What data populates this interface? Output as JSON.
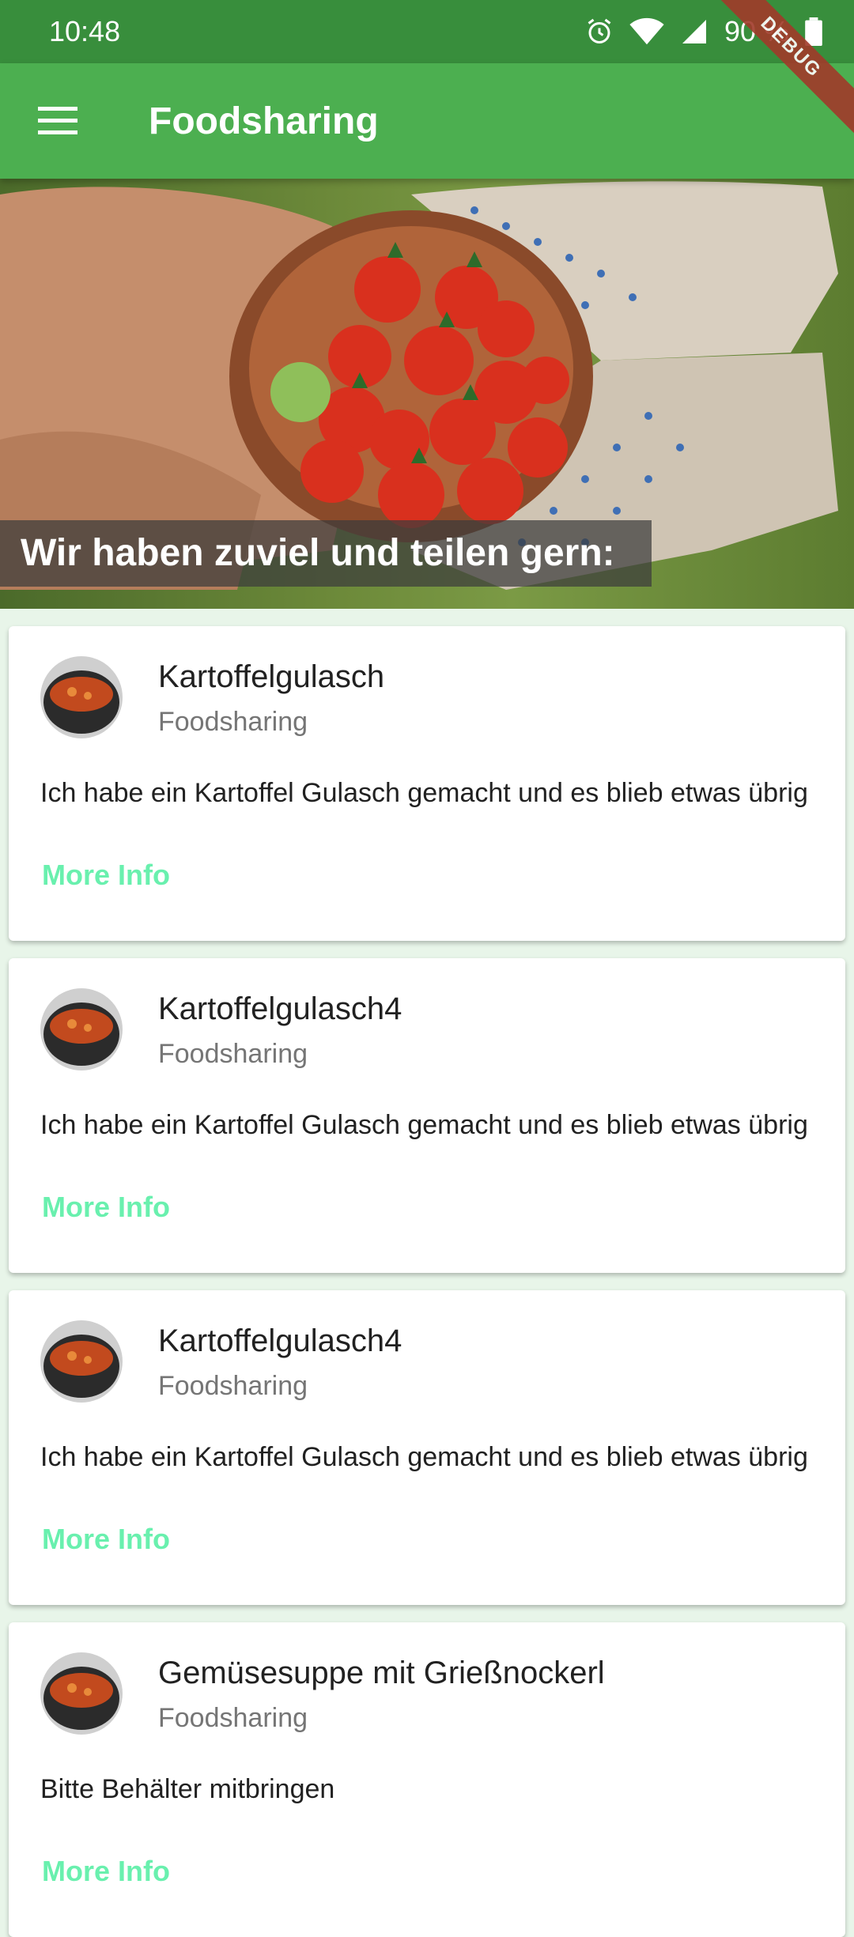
{
  "status_bar": {
    "time": "10:48",
    "battery": "90 %"
  },
  "debug_label": "DEBUG",
  "app_bar": {
    "title": "Foodsharing",
    "menu_icon": "hamburger-icon"
  },
  "hero": {
    "caption": "Wir haben zuviel und teilen gern:"
  },
  "cards": [
    {
      "title": "Kartoffelgulasch",
      "subtitle": "Foodsharing",
      "text": "Ich habe ein Kartoffel Gulasch gemacht und es blieb etwas übrig",
      "link": "More Info"
    },
    {
      "title": "Kartoffelgulasch4",
      "subtitle": "Foodsharing",
      "text": "Ich habe ein Kartoffel Gulasch gemacht und es blieb etwas übrig",
      "link": "More Info"
    },
    {
      "title": "Kartoffelgulasch4",
      "subtitle": "Foodsharing",
      "text": "Ich habe ein Kartoffel Gulasch gemacht und es blieb etwas übrig",
      "link": "More Info"
    },
    {
      "title": "Gemüsesuppe mit Grießnockerl",
      "subtitle": "Foodsharing",
      "text": "Bitte Behälter mitbringen",
      "link": "More Info"
    }
  ],
  "colors": {
    "primary": "#4caf50",
    "primary_dark": "#388e3c",
    "accent": "#69f0ae"
  }
}
